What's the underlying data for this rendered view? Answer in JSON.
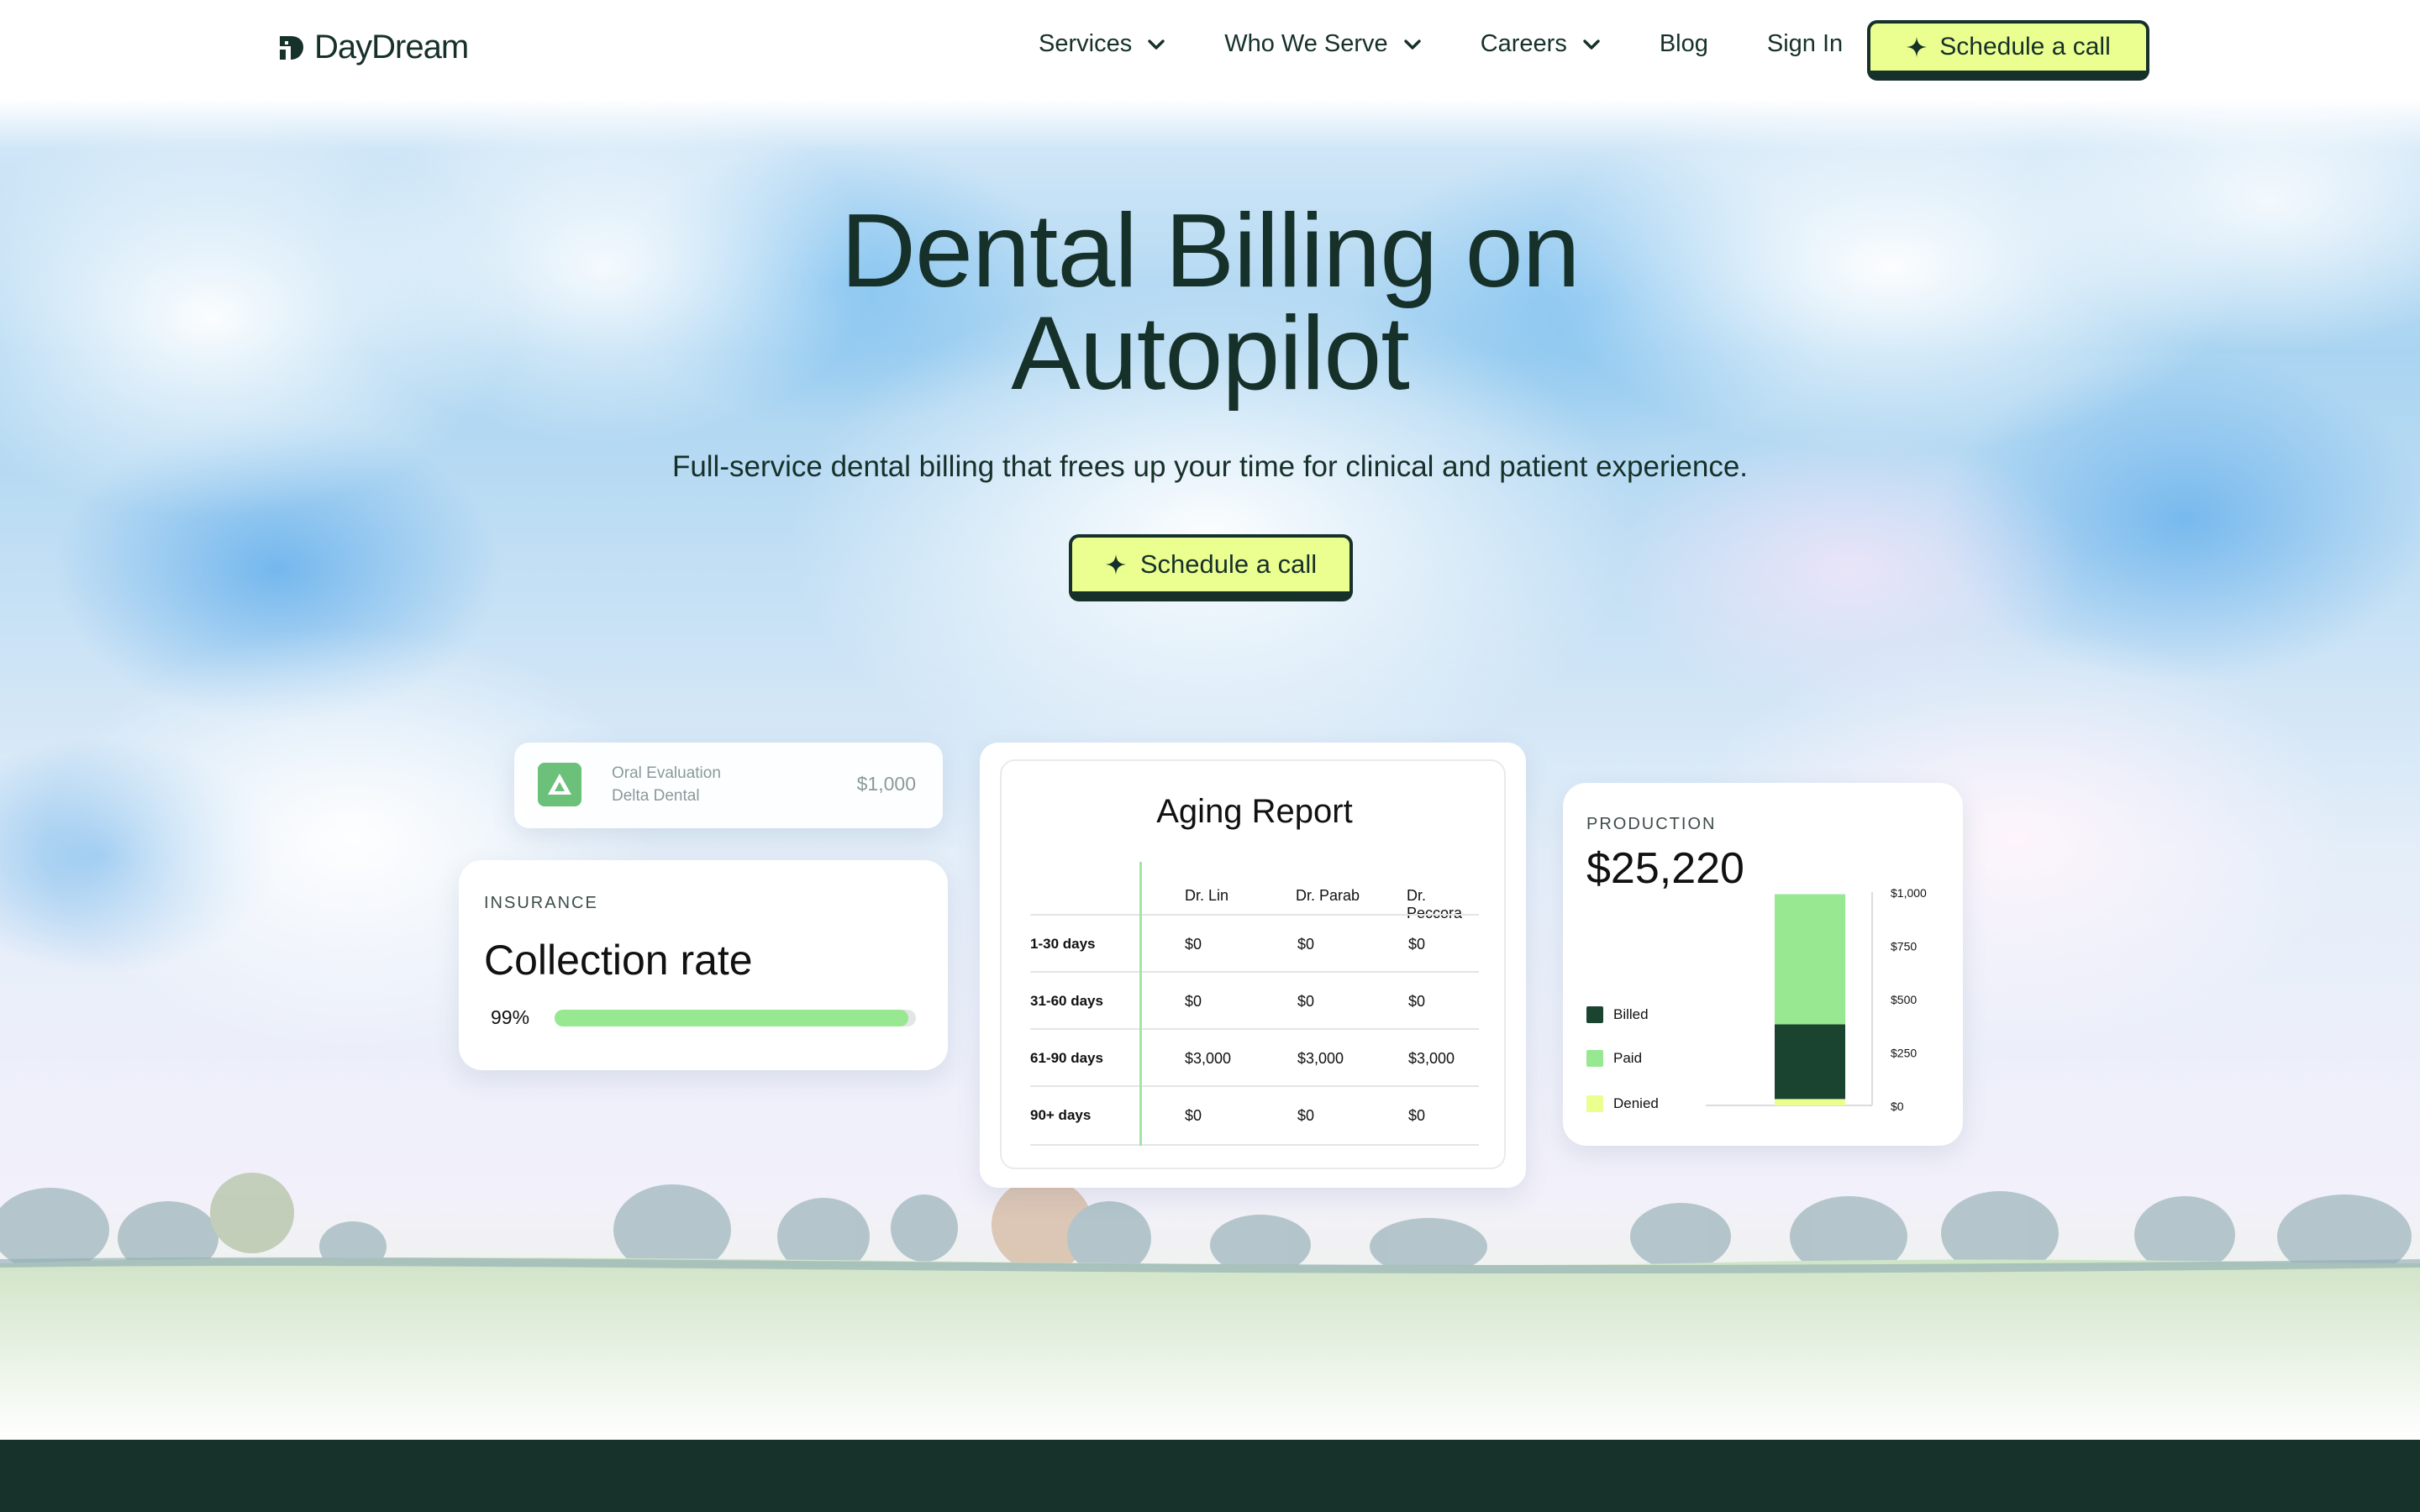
{
  "brand": {
    "name": "DayDream"
  },
  "nav": {
    "items": [
      {
        "label": "Services",
        "has_dropdown": true
      },
      {
        "label": "Who We Serve",
        "has_dropdown": true
      },
      {
        "label": "Careers",
        "has_dropdown": true
      },
      {
        "label": "Blog",
        "has_dropdown": false
      },
      {
        "label": "Sign In",
        "has_dropdown": false
      }
    ],
    "cta_label": "Schedule a call"
  },
  "hero": {
    "title_line1": "Dental Billing on",
    "title_line2": "Autopilot",
    "subtitle": "Full-service dental billing that frees up your time for clinical and patient experience.",
    "cta_label": "Schedule a call"
  },
  "claim": {
    "procedure": "Oral Evaluation",
    "payer": "Delta Dental",
    "amount": "$1,000"
  },
  "collection": {
    "eyebrow": "INSURANCE",
    "title": "Collection rate",
    "percent_label": "99%",
    "progress": 0.98
  },
  "aging": {
    "title": "Aging Report",
    "columns": [
      "Dr. Lin",
      "Dr. Parab",
      "Dr. Peccora"
    ],
    "rows": [
      {
        "label": "1-30 days",
        "values": [
          "$0",
          "$0",
          "$0"
        ]
      },
      {
        "label": "31-60 days",
        "values": [
          "$0",
          "$0",
          "$0"
        ]
      },
      {
        "label": "61-90 days",
        "values": [
          "$3,000",
          "$3,000",
          "$3,000"
        ]
      },
      {
        "label": "90+ days",
        "values": [
          "$0",
          "$0",
          "$0"
        ]
      }
    ]
  },
  "production": {
    "eyebrow": "PRODUCTION",
    "total": "$25,220",
    "legend": [
      "Billed",
      "Paid",
      "Denied"
    ]
  },
  "chart_data": {
    "type": "bar",
    "stacked": true,
    "categories": [
      ""
    ],
    "series": [
      {
        "name": "Denied",
        "values": [
          30
        ],
        "color": "#eaff8f"
      },
      {
        "name": "Billed",
        "values": [
          350
        ],
        "color": "#1b4430"
      },
      {
        "name": "Paid",
        "values": [
          610
        ],
        "color": "#97e891"
      }
    ],
    "yticks": [
      "$1,000",
      "$750",
      "$500",
      "$250",
      "$0"
    ],
    "ylim": [
      0,
      1000
    ],
    "legend_position": "left"
  },
  "colors": {
    "ink": "#16302a",
    "accent": "#eaff8f",
    "green_light": "#97e891",
    "green_dark": "#1b4430",
    "footer": "#17322b"
  }
}
